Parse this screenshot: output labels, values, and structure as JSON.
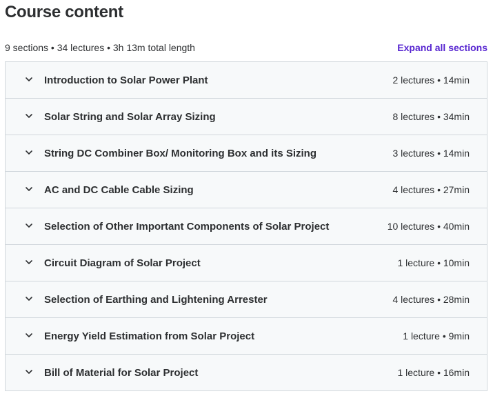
{
  "header": {
    "title": "Course content",
    "summary": "9 sections • 34 lectures • 3h 13m total length",
    "expand_label": "Expand all sections"
  },
  "accent_color": "#5624d0",
  "icons": {
    "section_toggle": "chevron-down-icon"
  },
  "sections": [
    {
      "title": "Introduction to Solar Power Plant",
      "meta": "2 lectures • 14min"
    },
    {
      "title": "Solar String and Solar Array Sizing",
      "meta": "8 lectures • 34min"
    },
    {
      "title": "String DC Combiner Box/ Monitoring Box and its Sizing",
      "meta": "3 lectures • 14min"
    },
    {
      "title": "AC and DC Cable Cable Sizing",
      "meta": "4 lectures • 27min"
    },
    {
      "title": "Selection of Other Important Components of Solar Project",
      "meta": "10 lectures • 40min"
    },
    {
      "title": "Circuit Diagram of Solar Project",
      "meta": "1 lecture • 10min"
    },
    {
      "title": "Selection of Earthing and Lightening Arrester",
      "meta": "4 lectures • 28min"
    },
    {
      "title": "Energy Yield Estimation from Solar Project",
      "meta": "1 lecture • 9min"
    },
    {
      "title": "Bill of Material for Solar Project",
      "meta": "1 lecture • 16min"
    }
  ]
}
